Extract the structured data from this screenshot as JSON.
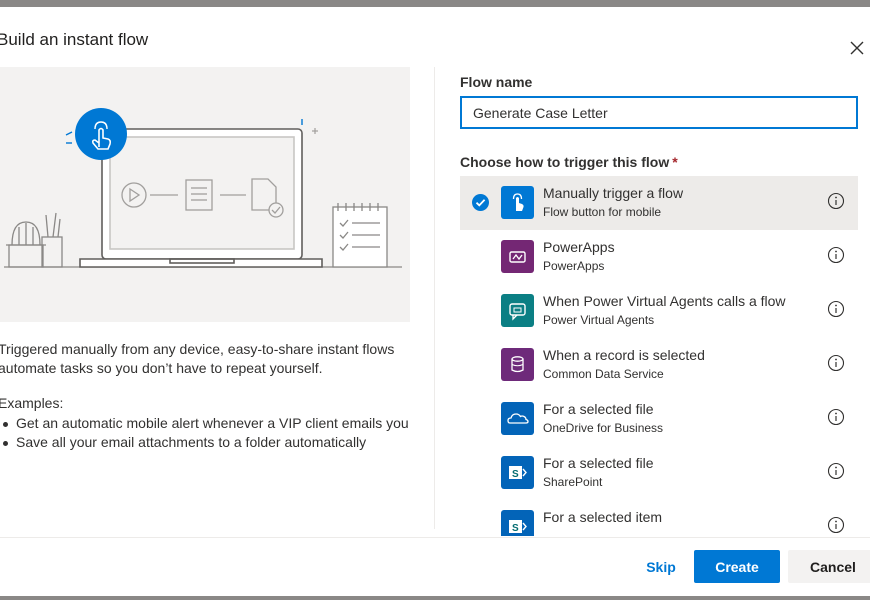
{
  "dialog": {
    "title": "Build an instant flow",
    "close_icon": "close-icon"
  },
  "left": {
    "description": "Triggered manually from any device, easy-to-share instant flows automate tasks so you don’t have to repeat yourself.",
    "examples_heading": "Examples:",
    "examples": [
      "Get an automatic mobile alert whenever a VIP client emails you",
      "Save all your email attachments to a folder automatically"
    ]
  },
  "form": {
    "flow_name_label": "Flow name",
    "flow_name_value": "Generate Case Letter",
    "trigger_label": "Choose how to trigger this flow",
    "required_marker": "*"
  },
  "triggers": [
    {
      "name": "Manually trigger a flow",
      "connector": "Flow button for mobile",
      "selected": true,
      "icon": "touch-icon",
      "color": "#0078d4"
    },
    {
      "name": "PowerApps",
      "connector": "PowerApps",
      "selected": false,
      "icon": "powerapps-icon",
      "color": "#742774"
    },
    {
      "name": "When Power Virtual Agents calls a flow",
      "connector": "Power Virtual Agents",
      "selected": false,
      "icon": "chat-bot-icon",
      "color": "#0b7f84"
    },
    {
      "name": "When a record is selected",
      "connector": "Common Data Service",
      "selected": false,
      "icon": "database-icon",
      "color": "#6e2a7a"
    },
    {
      "name": "For a selected file",
      "connector": "OneDrive for Business",
      "selected": false,
      "icon": "onedrive-icon",
      "color": "#0364b8"
    },
    {
      "name": "For a selected file",
      "connector": "SharePoint",
      "selected": false,
      "icon": "sharepoint-icon",
      "color": "#036c70"
    },
    {
      "name": "For a selected item",
      "connector": "",
      "selected": false,
      "icon": "sharepoint-icon",
      "color": "#036c70"
    }
  ],
  "footer": {
    "skip_label": "Skip",
    "create_label": "Create",
    "cancel_label": "Cancel"
  },
  "colors": {
    "accent": "#0078d4",
    "selected_row": "#edebe9",
    "illustration_bg": "#f3f2f1"
  }
}
